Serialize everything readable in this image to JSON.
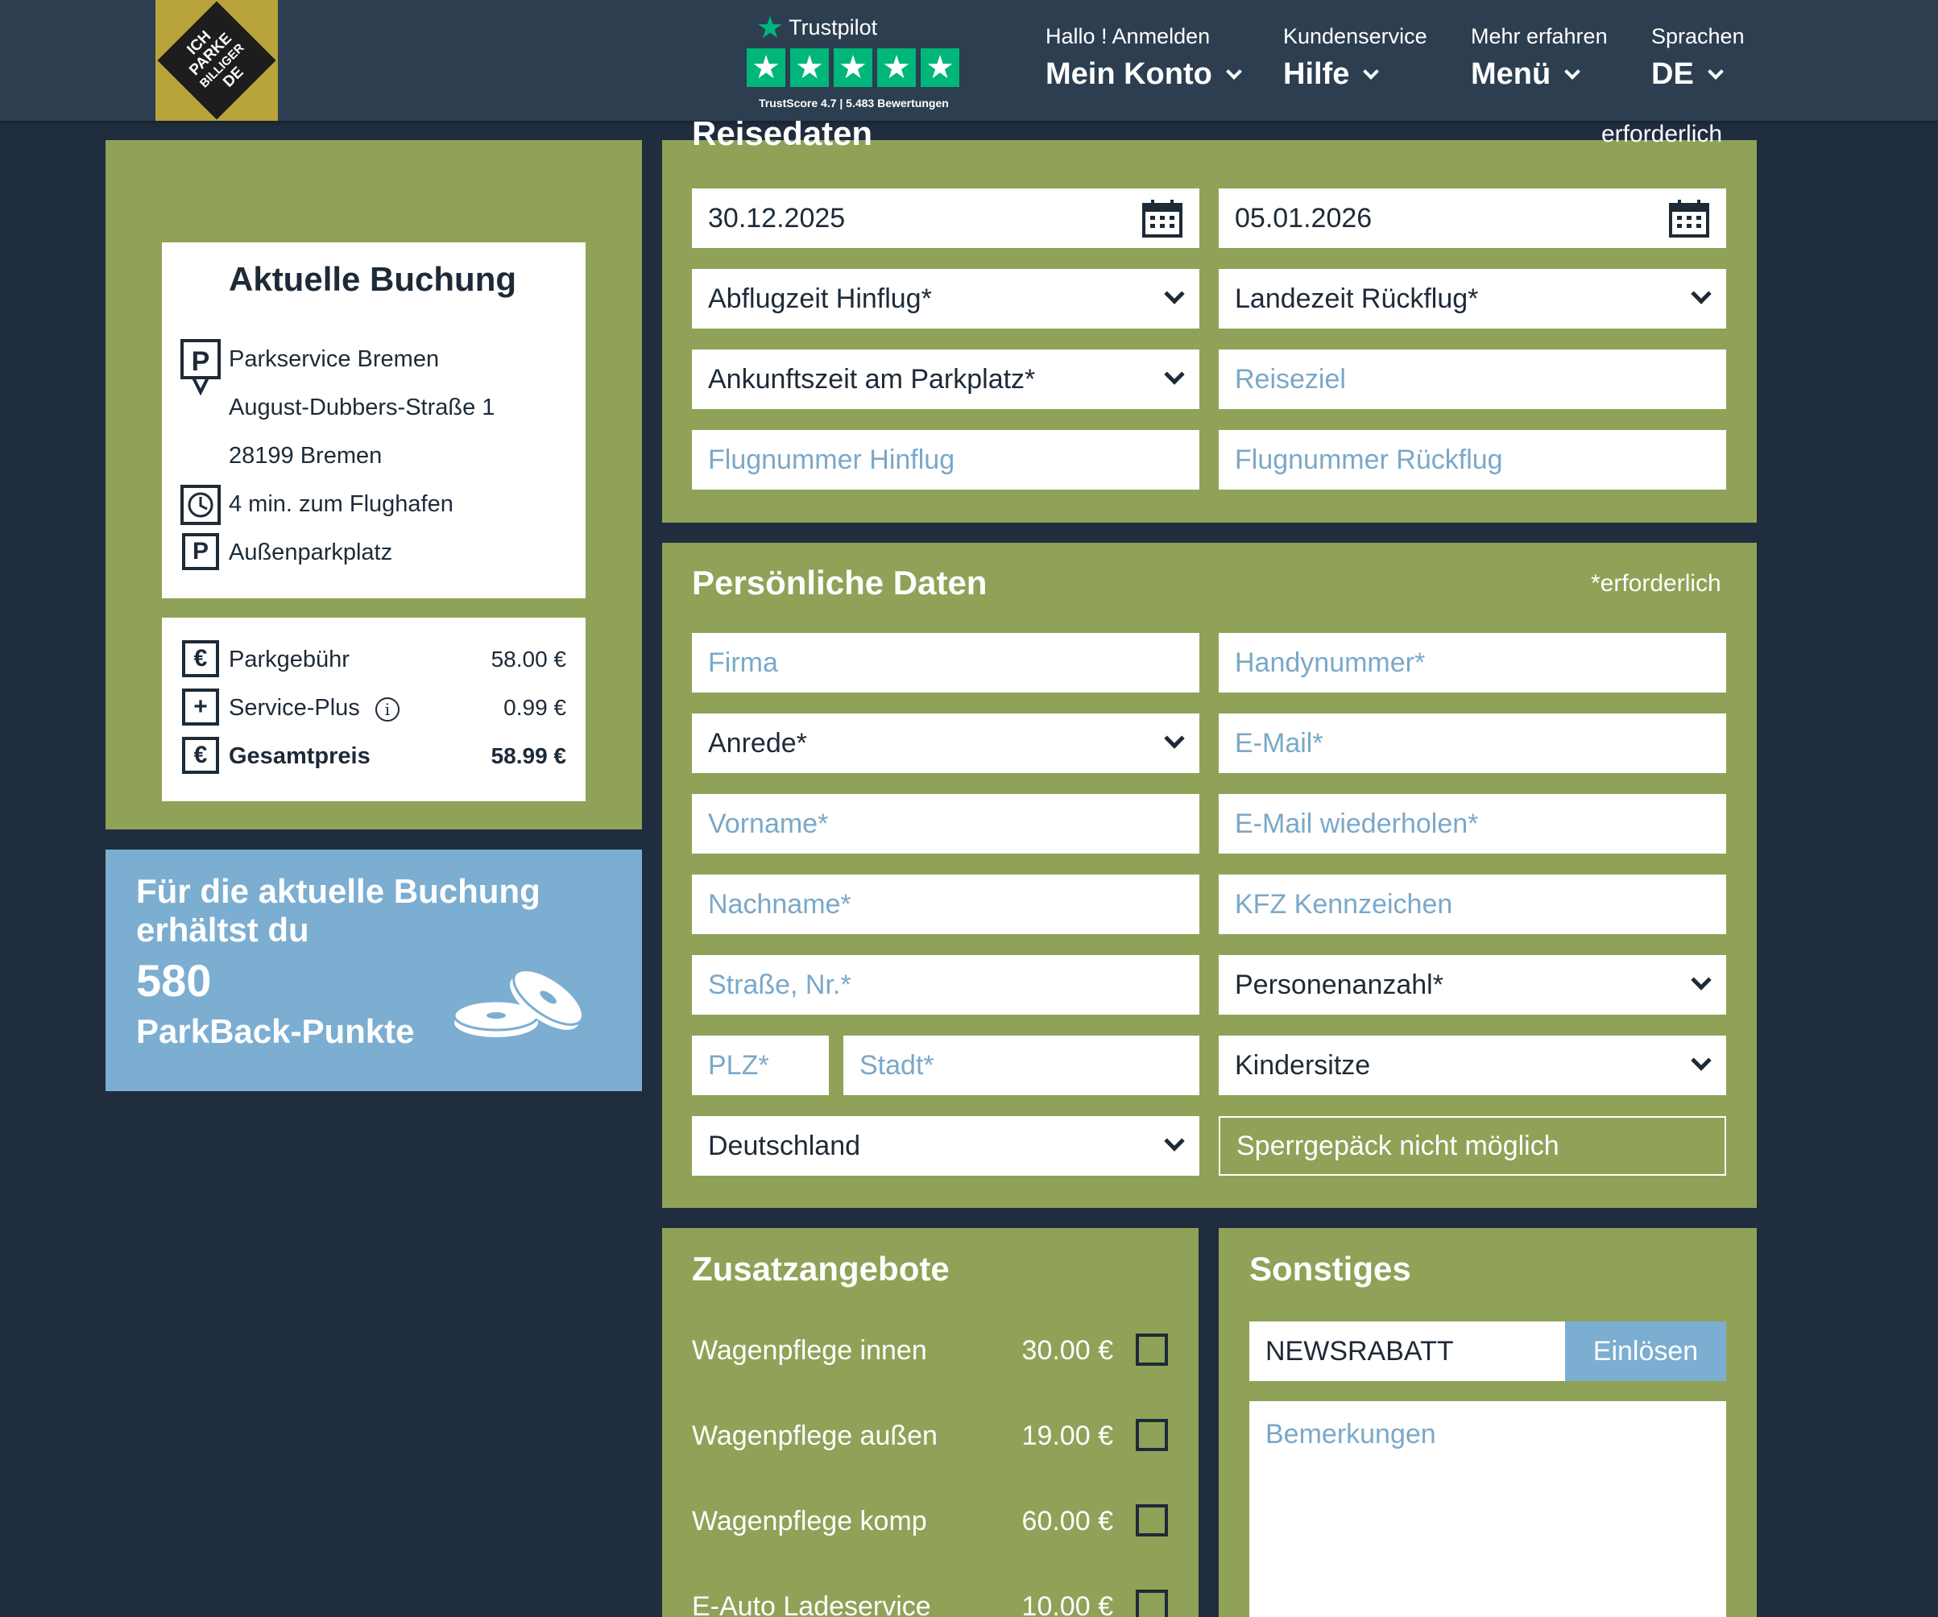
{
  "header": {
    "logo_lines": [
      "ICH",
      "PARKE",
      "BILLIGER",
      "DE"
    ],
    "trustpilot": {
      "brand": "Trustpilot",
      "stars": 5,
      "score_text": "TrustScore 4.7 | 5.483 Bewertungen"
    },
    "nav": [
      {
        "small": "Hallo ! Anmelden",
        "big": "Mein Konto"
      },
      {
        "small": "Kundenservice",
        "big": "Hilfe"
      },
      {
        "small": "Mehr erfahren",
        "big": "Menü"
      },
      {
        "small": "Sprachen",
        "big": "DE"
      }
    ]
  },
  "booking": {
    "title": "Aktuelle Buchung",
    "provider": "Parkservice Bremen",
    "street": "August-Dubbers-Straße 1",
    "city": "28199 Bremen",
    "distance": "4 min. zum Flughafen",
    "type": "Außenparkplatz",
    "prices": [
      {
        "label": "Parkgebühr",
        "value": "58.00 €",
        "icon": "euro-icon"
      },
      {
        "label": "Service-Plus",
        "value": "0.99 €",
        "icon": "plus-icon"
      },
      {
        "label": "Gesamtpreis",
        "value": "58.99 €",
        "icon": "euro-icon"
      }
    ]
  },
  "points": {
    "text": "Für die aktuelle Buchung erhältst du",
    "number": "580",
    "label": "ParkBack-Punkte"
  },
  "reise": {
    "title": "Reisedaten",
    "required": "erforderlich",
    "date_from": "30.12.2025",
    "date_to": "05.01.2026",
    "abflugzeit": "Abflugzeit Hinflug*",
    "landezeit": "Landezeit Rückflug*",
    "ankunftszeit": "Ankunftszeit am Parkplatz*",
    "reiseziel_ph": "Reiseziel",
    "flug_hin_ph": "Flugnummer Hinflug",
    "flug_rueck_ph": "Flugnummer Rückflug"
  },
  "personal": {
    "title": "Persönliche Daten",
    "required": "*erforderlich",
    "firma_ph": "Firma",
    "handy_ph": "Handynummer*",
    "anrede": "Anrede*",
    "email_ph": "E-Mail*",
    "vorname_ph": "Vorname*",
    "email_repeat_ph": "E-Mail wiederholen*",
    "nachname_ph": "Nachname*",
    "kfz_ph": "KFZ Kennzeichen",
    "strasse_ph": "Straße, Nr.*",
    "personen": "Personenanzahl*",
    "plz_ph": "PLZ*",
    "stadt_ph": "Stadt*",
    "kindersitze": "Kindersitze",
    "land": "Deutschland",
    "sperrgepaeck": "Sperrgepäck nicht möglich"
  },
  "zusatz": {
    "title": "Zusatzangebote",
    "items": [
      {
        "label": "Wagenpflege innen",
        "price": "30.00 €"
      },
      {
        "label": "Wagenpflege außen",
        "price": "19.00 €"
      },
      {
        "label": "Wagenpflege komp",
        "price": "60.00 €"
      },
      {
        "label": "E-Auto Ladeservice",
        "price": "10.00 €"
      }
    ]
  },
  "sonstiges": {
    "title": "Sonstiges",
    "coupon_value": "NEWSRABATT",
    "coupon_button": "Einlösen",
    "remarks_ph": "Bemerkungen"
  },
  "colors": {
    "background": "#1f2d3e",
    "header": "#2c3e50",
    "panel_green": "#8fa257",
    "accent_blue": "#7baed1",
    "trustpilot_green": "#00b67a",
    "logo_gold": "#b8a43a"
  }
}
